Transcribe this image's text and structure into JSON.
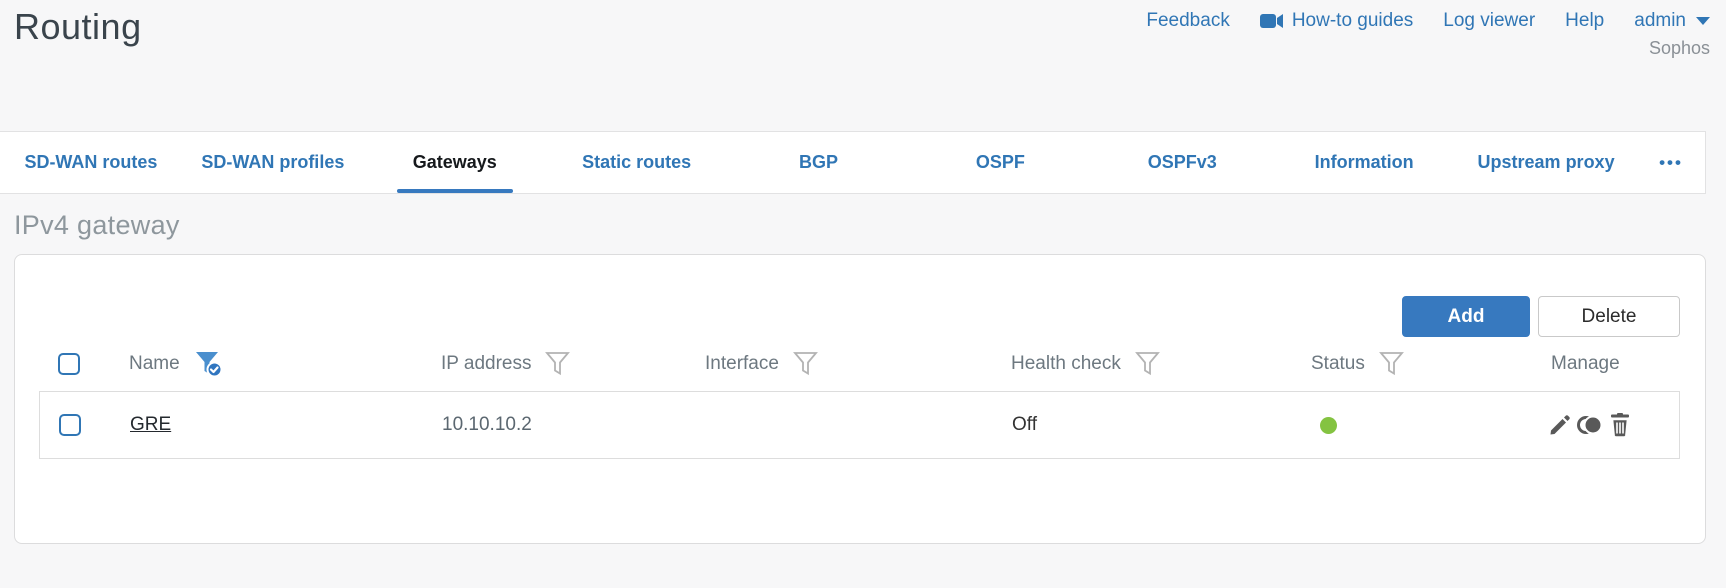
{
  "page": {
    "title": "Routing"
  },
  "topnav": {
    "feedback": "Feedback",
    "howto": "How-to guides",
    "logviewer": "Log viewer",
    "help": "Help",
    "user": "admin",
    "brand": "Sophos"
  },
  "tabs": {
    "items": [
      {
        "label": "SD-WAN routes",
        "active": false
      },
      {
        "label": "SD-WAN profiles",
        "active": false
      },
      {
        "label": "Gateways",
        "active": true
      },
      {
        "label": "Static routes",
        "active": false
      },
      {
        "label": "BGP",
        "active": false
      },
      {
        "label": "OSPF",
        "active": false
      },
      {
        "label": "OSPFv3",
        "active": false
      },
      {
        "label": "Information",
        "active": false
      },
      {
        "label": "Upstream proxy",
        "active": false
      }
    ],
    "more": "•••"
  },
  "section": {
    "title": "IPv4 gateway"
  },
  "toolbar": {
    "add_label": "Add",
    "delete_label": "Delete"
  },
  "table": {
    "columns": [
      {
        "label": "Name",
        "filter": "active"
      },
      {
        "label": "IP address",
        "filter": "inactive"
      },
      {
        "label": "Interface",
        "filter": "inactive"
      },
      {
        "label": "Health check",
        "filter": "inactive"
      },
      {
        "label": "Status",
        "filter": "inactive"
      },
      {
        "label": "Manage",
        "filter": "none"
      }
    ],
    "rows": [
      {
        "name": "GRE",
        "ip_address": "10.10.10.2",
        "interface": "",
        "health_check": "Off",
        "status_color": "#84c341",
        "manage": [
          "edit-icon",
          "clone-icon",
          "delete-icon"
        ]
      }
    ]
  },
  "colors": {
    "accent_blue": "#3779bf",
    "link_blue": "#3076b5",
    "status_green": "#84c341",
    "page_bg": "#f7f7f8"
  }
}
